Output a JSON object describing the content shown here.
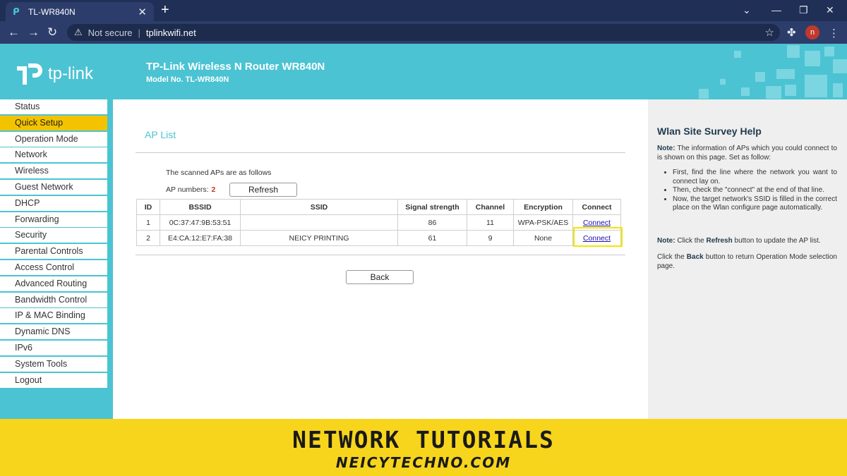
{
  "browser": {
    "tab_title": "TL-WR840N",
    "tab_close": "✕",
    "new_tab": "+",
    "security_label": "Not secure",
    "url": "tplinkwifi.net",
    "avatar_letter": "n"
  },
  "router_header": {
    "logo_text": "tp-link",
    "title": "TP-Link Wireless N Router WR840N",
    "model_no": "Model No. TL-WR840N",
    "brand_color": "#4bc3d3"
  },
  "sidebar": {
    "items": [
      {
        "label": "Status"
      },
      {
        "label": "Quick Setup",
        "active": true
      },
      {
        "label": "Operation Mode"
      },
      {
        "label": "Network"
      },
      {
        "label": "Wireless"
      },
      {
        "label": "Guest Network"
      },
      {
        "label": "DHCP"
      },
      {
        "label": "Forwarding"
      },
      {
        "label": "Security"
      },
      {
        "label": "Parental Controls"
      },
      {
        "label": "Access Control"
      },
      {
        "label": "Advanced Routing"
      },
      {
        "label": "Bandwidth Control"
      },
      {
        "label": "IP & MAC Binding"
      },
      {
        "label": "Dynamic DNS"
      },
      {
        "label": "IPv6"
      },
      {
        "label": "System Tools"
      },
      {
        "label": "Logout"
      }
    ]
  },
  "main": {
    "section_title": "AP List",
    "scanned_text": "The scanned APs are as follows",
    "ap_numbers_label": "AP numbers:",
    "ap_numbers_value": "2",
    "refresh_label": "Refresh",
    "back_label": "Back",
    "table": {
      "headers": [
        "ID",
        "BSSID",
        "SSID",
        "Signal strength",
        "Channel",
        "Encryption",
        "Connect"
      ],
      "rows": [
        [
          "1",
          "0C:37:47:9B:53:51",
          "",
          "86",
          "11",
          "WPA-PSK/AES",
          "Connect"
        ],
        [
          "2",
          "E4:CA:12:E7:FA:38",
          "NEICY PRINTING",
          "61",
          "9",
          "None",
          "Connect"
        ]
      ]
    }
  },
  "help": {
    "title": "Wlan Site Survey Help",
    "note_label": "Note:",
    "note_text": "The information of APs which you could connect to is shown on this page. Set as follow:",
    "bullets": [
      "First, find the line where the network you want to connect lay on.",
      "Then, check the \"connect\" at the end of that line.",
      "Now, the target network's SSID is filled in the correct place on the Wlan configure page automatically."
    ],
    "note2_label": "Note:",
    "note2_pre": "Click the",
    "note2_bold": "Refresh",
    "note2_post": "button to update the AP list.",
    "back_pre": "Click the",
    "back_bold": "Back",
    "back_post": "button to return Operation Mode selection page."
  },
  "banner": {
    "title": "NETWORK TUTORIALS",
    "subtitle": "NEICYTECHNO.COM",
    "color": "#f7d51c"
  }
}
